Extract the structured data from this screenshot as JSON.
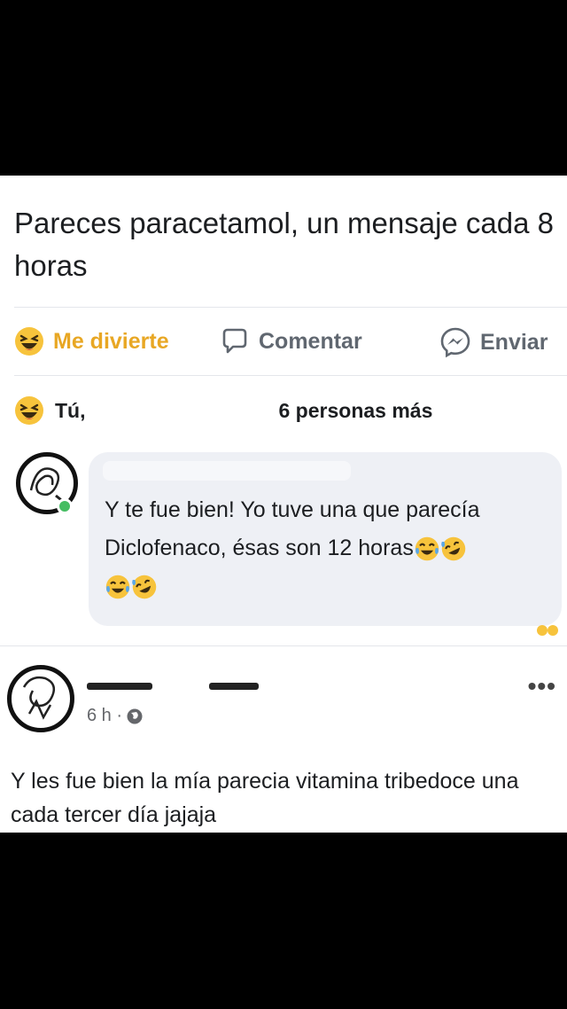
{
  "post": {
    "text": "Pareces paracetamol, un mensaje cada 8 horas"
  },
  "actions": {
    "react_label": "Me divierte",
    "comment_label": "Comentar",
    "send_label": "Enviar"
  },
  "reactions": {
    "you": "Tú,",
    "others": "6 personas más"
  },
  "comment1": {
    "text": "Y te fue bien! Yo tuve una que parecía Diclofenaco, ésas son 12 horas"
  },
  "post2": {
    "time": "6 h ·",
    "text": "Y les fue bien la mía parecia vitamina tribedoce una cada tercer día jajaja"
  },
  "colors": {
    "react": "#e8a724",
    "muted": "#606770",
    "online": "#45bd62",
    "bubble": "#eef0f5"
  }
}
